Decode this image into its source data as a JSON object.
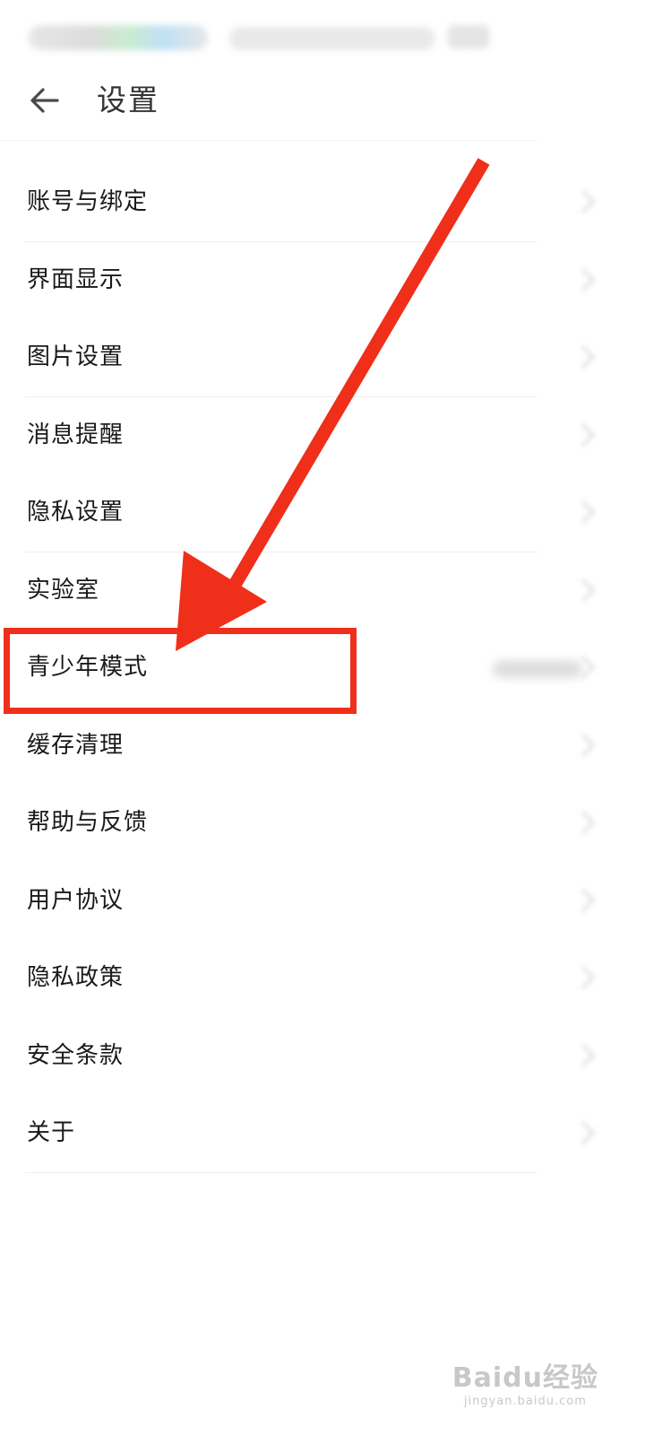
{
  "header": {
    "title": "设置"
  },
  "settings": [
    {
      "label": "账号与绑定"
    },
    {
      "label": "界面显示"
    },
    {
      "label": "图片设置"
    },
    {
      "label": "消息提醒"
    },
    {
      "label": "隐私设置"
    },
    {
      "label": "实验室"
    },
    {
      "label": "青少年模式"
    },
    {
      "label": "缓存清理"
    },
    {
      "label": "帮助与反馈"
    },
    {
      "label": "用户协议"
    },
    {
      "label": "隐私政策"
    },
    {
      "label": "安全条款"
    },
    {
      "label": "关于"
    }
  ],
  "annotation": {
    "color": "#ef2f1a"
  },
  "watermark": {
    "main": "Baidu经验",
    "sub": "jingyan.baidu.com"
  }
}
